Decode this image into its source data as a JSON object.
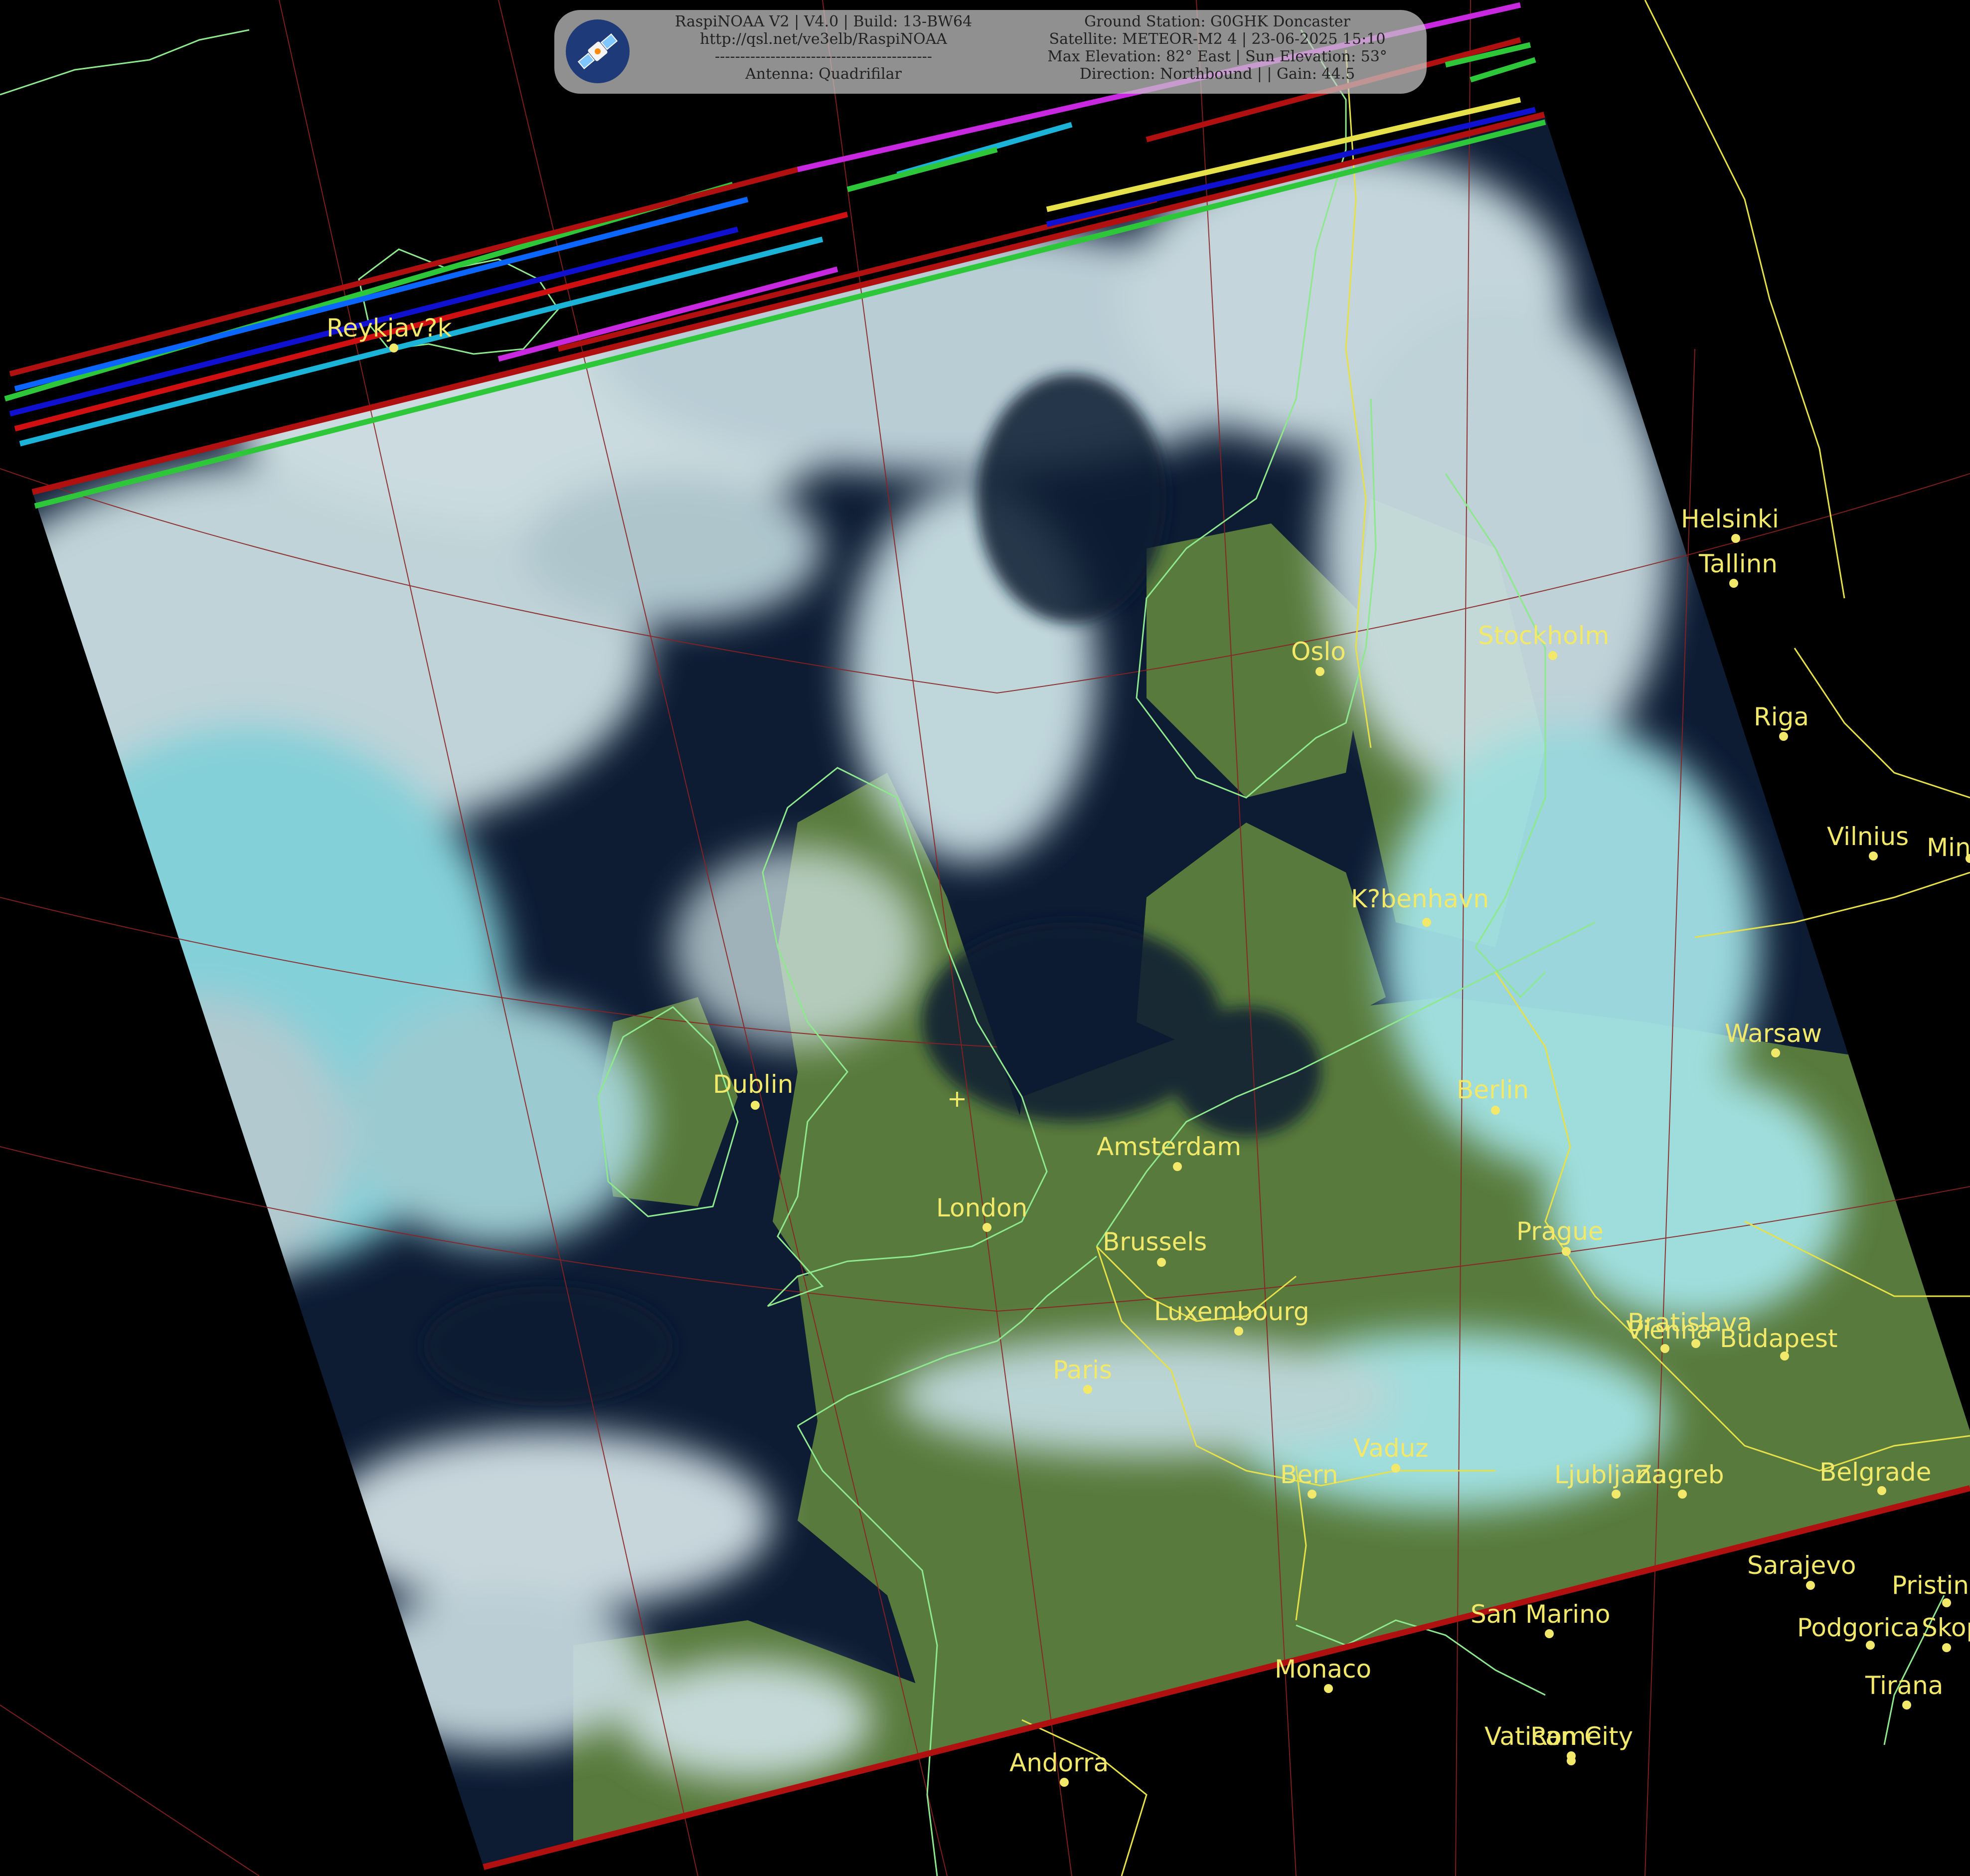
{
  "header": {
    "line1": "RaspiNOAA V2 | V4.0 | Build: 13-BW64",
    "line2": "http://qsl.net/ve3elb/RaspiNOAA",
    "line3": "-------------------------------------------",
    "line4": "Antenna: Quadrifilar",
    "line5": "Ground Station: G0GHK Doncaster",
    "line6": "Satellite: METEOR-M2 4 | 23-06-2025 15:10",
    "line7": "Max Elevation: 82° East | Sun Elevation: 53°",
    "line8": "Direction: Northbound | | Gain: 44.5"
  },
  "icons": {
    "logo": "satellite-icon",
    "station": "crosshair-icon"
  },
  "colors": {
    "label": "#f2e86a",
    "coast": "#8ee88e",
    "border": "#e6e04a",
    "graticule": "#8a2222",
    "ocean": "#0d1b33",
    "land": "#587a3c",
    "cloud": "#cfe3e6",
    "cloud_cyan": "#8fe0e6"
  },
  "cities": [
    {
      "name": "Reykjav?k"
    },
    {
      "name": "Helsinki"
    },
    {
      "name": "Tallinn"
    },
    {
      "name": "Oslo"
    },
    {
      "name": "Stockholm"
    },
    {
      "name": "Riga"
    },
    {
      "name": "Vilnius"
    },
    {
      "name": "Min"
    },
    {
      "name": "K?benhavn"
    },
    {
      "name": "Warsaw"
    },
    {
      "name": "Dublin"
    },
    {
      "name": "Berlin"
    },
    {
      "name": "Amsterdam"
    },
    {
      "name": "London"
    },
    {
      "name": "Brussels"
    },
    {
      "name": "Prague"
    },
    {
      "name": "Luxembourg"
    },
    {
      "name": "Bratislava"
    },
    {
      "name": "Vienna"
    },
    {
      "name": "Budapest"
    },
    {
      "name": "Paris"
    },
    {
      "name": "Vaduz"
    },
    {
      "name": "Bern"
    },
    {
      "name": "Ljubljana"
    },
    {
      "name": "Zagreb"
    },
    {
      "name": "Belgrade"
    },
    {
      "name": "Sarajevo"
    },
    {
      "name": "Pristina"
    },
    {
      "name": "San Marino"
    },
    {
      "name": "Podgorica"
    },
    {
      "name": "Skopje"
    },
    {
      "name": "Monaco"
    },
    {
      "name": "Tirana"
    },
    {
      "name": "Vatican City"
    },
    {
      "name": "Rome"
    },
    {
      "name": "Andorra"
    }
  ]
}
